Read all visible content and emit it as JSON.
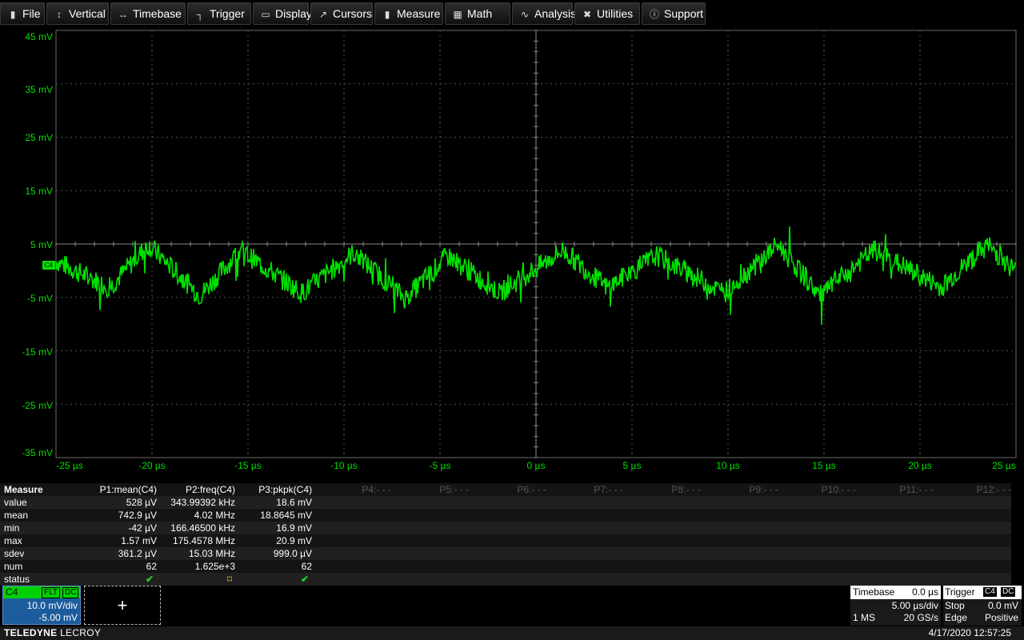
{
  "menu": [
    {
      "label": "File",
      "icon": "file-icon",
      "glyph": "▮"
    },
    {
      "label": "Vertical",
      "icon": "vertical-arrows-icon",
      "glyph": "↕"
    },
    {
      "label": "Timebase",
      "icon": "horizontal-arrows-icon",
      "glyph": "↔"
    },
    {
      "label": "Trigger",
      "icon": "trigger-icon",
      "glyph": "┐"
    },
    {
      "label": "Display",
      "icon": "display-icon",
      "glyph": "▭"
    },
    {
      "label": "Cursors",
      "icon": "cursor-icon",
      "glyph": "↗"
    },
    {
      "label": "Measure",
      "icon": "measure-icon",
      "glyph": "▮"
    },
    {
      "label": "Math",
      "icon": "math-icon",
      "glyph": "▦"
    },
    {
      "label": "Analysis",
      "icon": "analysis-icon",
      "glyph": "∿"
    },
    {
      "label": "Utilities",
      "icon": "utilities-icon",
      "glyph": "✖"
    },
    {
      "label": "Support",
      "icon": "support-icon",
      "glyph": "ⓘ"
    }
  ],
  "chart_data": {
    "type": "line",
    "trace_color": "#00e000",
    "y_tick_labels": [
      "45 mV",
      "35 mV",
      "25 mV",
      "15 mV",
      "5 mV",
      "-5 mV",
      "-15 mV",
      "-25 mV",
      "-35 mV"
    ],
    "x_tick_labels": [
      "-25 µs",
      "-20 µs",
      "-15 µs",
      "-10 µs",
      "-5 µs",
      "0 µs",
      "5 µs",
      "10 µs",
      "15 µs",
      "20 µs",
      "25 µs"
    ],
    "ylim_mV": [
      -35,
      45
    ],
    "xlim_us": [
      -25,
      25
    ],
    "grid": true,
    "channel_marker": "C4",
    "series": [
      {
        "name": "C4",
        "x_us": [
          -25,
          -23.9,
          -22.2,
          -20.2,
          -17.5,
          -15.4,
          -12.2,
          -9.5,
          -6.8,
          -4.6,
          -1.9,
          1.4,
          3.7,
          6.3,
          9.8,
          12.6,
          14.8,
          17.6,
          21.1,
          23.5,
          25
        ],
        "y_mV": [
          2,
          0,
          -3,
          5,
          -4.5,
          4,
          -4,
          3.5,
          -5,
          3,
          -4,
          4,
          -3,
          3,
          -4,
          5,
          -4.5,
          4,
          -3,
          5,
          0
        ]
      }
    ]
  },
  "measure": {
    "title": "Measure",
    "columns": [
      "P1:mean(C4)",
      "P2:freq(C4)",
      "P3:pkpk(C4)"
    ],
    "empty_params": [
      "P4:- - -",
      "P5:- - -",
      "P6:- - -",
      "P7:- - -",
      "P8:- - -",
      "P9:- - -",
      "P10:- - -",
      "P11:- - -",
      "P12:- - -"
    ],
    "rows": [
      {
        "label": "value",
        "cells": [
          "528 µV",
          "343.99392 kHz",
          "18.6 mV"
        ]
      },
      {
        "label": "mean",
        "cells": [
          "742.9 µV",
          "4.02 MHz",
          "18.8645 mV"
        ]
      },
      {
        "label": "min",
        "cells": [
          "-42 µV",
          "166.46500 kHz",
          "16.9 mV"
        ]
      },
      {
        "label": "max",
        "cells": [
          "1.57 mV",
          "175.4578 MHz",
          "20.9 mV"
        ]
      },
      {
        "label": "sdev",
        "cells": [
          "361.2 µV",
          "15.03 MHz",
          "999.0 µV"
        ]
      },
      {
        "label": "num",
        "cells": [
          "62",
          "1.625e+3",
          "62"
        ]
      },
      {
        "label": "status",
        "cells": [
          "✔",
          "⌑",
          "✔"
        ]
      }
    ]
  },
  "channel": {
    "name": "C4",
    "tags": [
      "FLT",
      "DC"
    ],
    "vdiv": "10.0 mV/div",
    "offset": "-5.00 mV"
  },
  "add_trace": {
    "glyph": "+"
  },
  "timebase": {
    "title": "Timebase",
    "delay": "0.0 µs",
    "per_div": "5.00 µs/div",
    "points": "1 MS",
    "rate": "20 GS/s"
  },
  "trigger": {
    "title": "Trigger",
    "source": "C4",
    "coupling": "DC",
    "mode": "Stop",
    "level": "0.0 mV",
    "type": "Edge",
    "slope": "Positive"
  },
  "status_bar": {
    "brand_bold": "TELEDYNE",
    "brand_light": "LECROY",
    "datetime": "4/17/2020 12:57:25"
  }
}
